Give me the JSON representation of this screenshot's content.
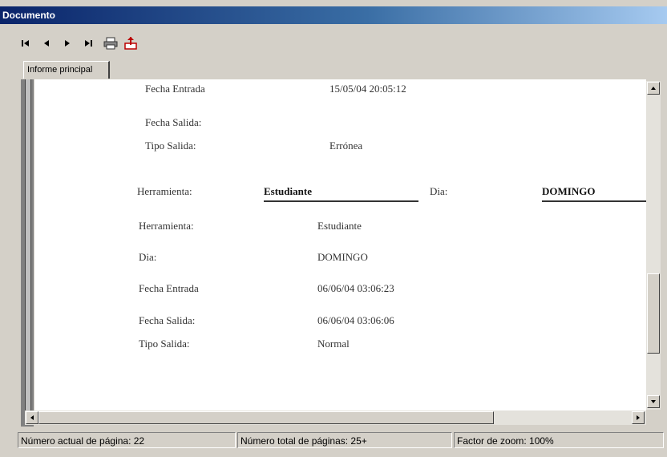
{
  "window": {
    "title": "Documento"
  },
  "toolbar": {
    "buttons": [
      {
        "icon": "first-page-icon",
        "glyph": "⏮"
      },
      {
        "icon": "previous-page-icon",
        "glyph": "◀"
      },
      {
        "icon": "next-page-icon",
        "glyph": "▶"
      },
      {
        "icon": "last-page-icon",
        "glyph": "⏭"
      },
      {
        "icon": "print-icon",
        "glyph": "🖨"
      },
      {
        "icon": "export-icon",
        "glyph": "⬆"
      }
    ]
  },
  "tabs": [
    {
      "label": "Informe principal"
    }
  ],
  "report": {
    "rows_top": [
      {
        "label": "Fecha Entrada",
        "value": "15/05/04 20:05:12"
      },
      {
        "label": "Fecha Salida:",
        "value": ""
      },
      {
        "label": "Tipo Salida:",
        "value": "Errónea"
      }
    ],
    "group_header": {
      "tool_label": "Herramienta:",
      "tool_value": "Estudiante",
      "day_label": "Dia:",
      "day_value": "DOMINGO"
    },
    "rows_bottom": [
      {
        "label": "Herramienta:",
        "value": "Estudiante"
      },
      {
        "label": "Dia:",
        "value": "DOMINGO"
      },
      {
        "label": "Fecha Entrada",
        "value": "06/06/04 03:06:23"
      },
      {
        "label": "Fecha Salida:",
        "value": "06/06/04 03:06:06"
      },
      {
        "label": "Tipo Salida:",
        "value": "Normal"
      }
    ]
  },
  "status_bar": {
    "current_page": "Número actual de página: 22",
    "total_pages": "Número total de páginas: 25+",
    "zoom": "Factor de zoom: 100%"
  }
}
